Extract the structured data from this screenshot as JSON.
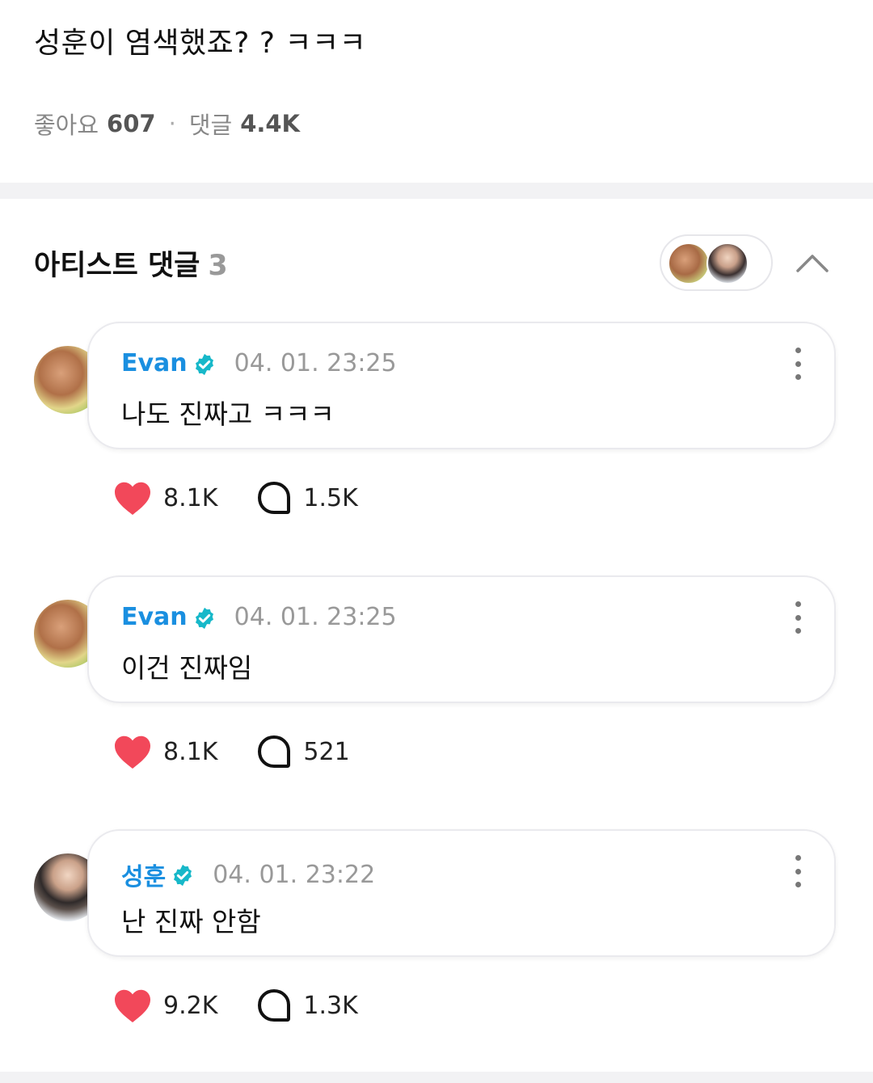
{
  "post": {
    "title": "성훈이 염색했죠? ? ㅋㅋㅋ",
    "likes_label": "좋아요",
    "likes_count": "607",
    "comments_label": "댓글",
    "comments_count": "4.4K",
    "separator": "·"
  },
  "artist_section": {
    "title": "아티스트 댓글",
    "count": "3"
  },
  "comments": [
    {
      "author": "Evan",
      "time": "04. 01. 23:25",
      "text": "나도 진짜고 ㅋㅋㅋ",
      "likes": "8.1K",
      "replies": "1.5K"
    },
    {
      "author": "Evan",
      "time": "04. 01. 23:25",
      "text": "이건 진짜임",
      "likes": "8.1K",
      "replies": "521"
    },
    {
      "author": "성훈",
      "time": "04. 01. 23:22",
      "text": "난 진짜 안함",
      "likes": "9.2K",
      "replies": "1.3K"
    }
  ],
  "icons": {
    "heart": "heart-icon",
    "reply": "speech-bubble-icon",
    "verified": "verified-badge-icon",
    "more": "more-vertical-icon",
    "collapse": "chevron-up-icon"
  },
  "colors": {
    "author": "#1a8fe0",
    "verified": "#17b8c9",
    "heart": "#f2485a",
    "muted": "#999999"
  }
}
